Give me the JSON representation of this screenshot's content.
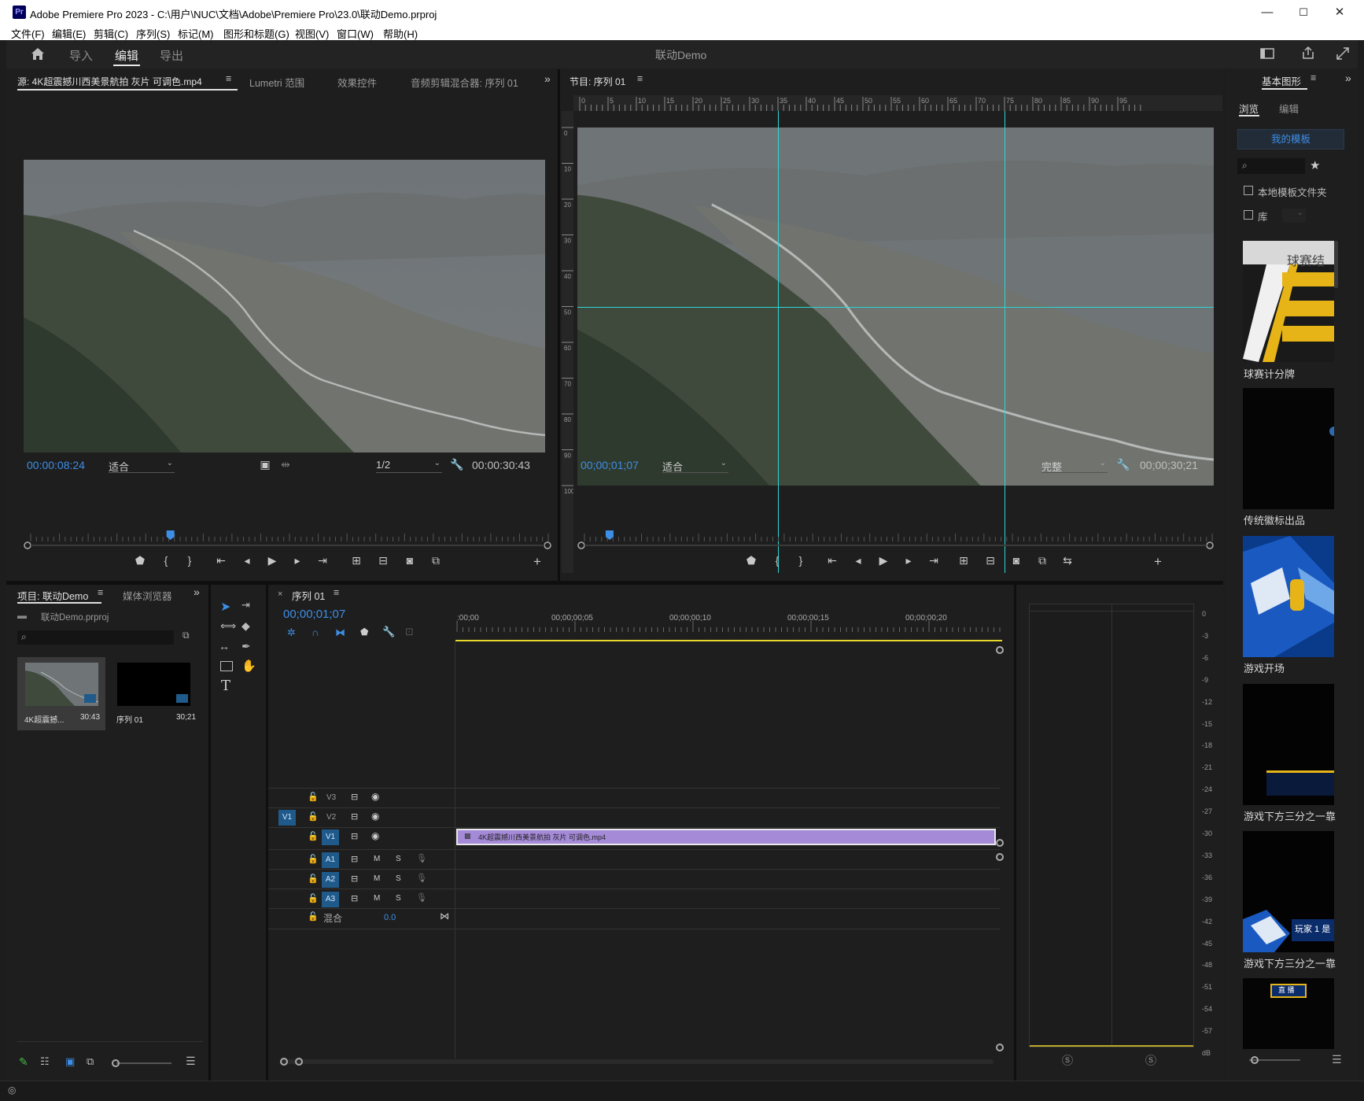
{
  "window": {
    "app_badge": "Pr",
    "title": "Adobe Premiere Pro 2023 - C:\\用户\\NUC\\文档\\Adobe\\Premiere Pro\\23.0\\联动Demo.prproj",
    "minimize": "—",
    "maximize": "☐",
    "close": "✕"
  },
  "menu": [
    "文件(F)",
    "编辑(E)",
    "剪辑(C)",
    "序列(S)",
    "标记(M)",
    "图形和标题(G)",
    "视图(V)",
    "窗口(W)",
    "帮助(H)"
  ],
  "workspace": {
    "tabs": [
      "导入",
      "编辑",
      "导出"
    ],
    "active": "编辑",
    "project_name": "联动Demo"
  },
  "source_panel": {
    "tabs": [
      "源: 4K超震撼川西美景航拍 灰片 可调色.mp4",
      "Lumetri 范围",
      "效果控件",
      "音频剪辑混合器: 序列 01"
    ],
    "current_time": "00:00:08:24",
    "fit": "适合",
    "resolution": "1/2",
    "duration": "00:00:30:43",
    "playhead_fraction": 0.27
  },
  "program_panel": {
    "tab": "节目: 序列 01",
    "ruler_ticks": [
      "0",
      "5",
      "10",
      "15",
      "20",
      "25",
      "30",
      "35",
      "40",
      "45",
      "50",
      "55",
      "60",
      "65",
      "70",
      "75",
      "80",
      "85",
      "90",
      "95"
    ],
    "v_ruler_ticks": [
      "0",
      "10",
      "20",
      "30",
      "40",
      "50",
      "60",
      "70",
      "80",
      "90",
      "100"
    ],
    "current_time": "00;00;01;07",
    "fit": "适合",
    "quality": "完整",
    "duration": "00;00;30;21",
    "playhead_fraction": 0.04
  },
  "project_panel": {
    "tabs": [
      "项目: 联动Demo",
      "媒体浏览器"
    ],
    "file": "联动Demo.prproj",
    "items": [
      {
        "name": "4K超震撼...",
        "duration": "30:43"
      },
      {
        "name": "序列 01",
        "duration": "30;21"
      }
    ]
  },
  "timeline": {
    "tab": "序列 01",
    "close": "×",
    "current_time": "00;00;01;07",
    "ruler_labels": [
      ":00;00",
      "00;00;00;05",
      "00;00;00;10",
      "00;00;00;15",
      "00;00;00;20"
    ],
    "video_tracks": [
      "V3",
      "V2",
      "V1"
    ],
    "source_patch": "V1",
    "audio_tracks": [
      "A1",
      "A2",
      "A3"
    ],
    "mix_label": "混合",
    "mix_value": "0.0",
    "clip_name": "4K超震撼川西美景航拍 灰片 可调色.mp4",
    "track_toggles": {
      "mute": "M",
      "solo": "S"
    }
  },
  "audio_meter": {
    "labels": [
      "0",
      "-3",
      "-6",
      "-9",
      "-12",
      "-15",
      "-18",
      "-21",
      "-24",
      "-27",
      "-30",
      "-33",
      "-36",
      "-39",
      "-42",
      "-45",
      "-48",
      "-51",
      "-54",
      "-57",
      "dB"
    ],
    "solo_left": "S",
    "solo_right": "S"
  },
  "essential_graphics": {
    "title": "基本图形",
    "tabs": [
      "浏览",
      "编辑"
    ],
    "my_templates": "我的模板",
    "local_folder": "本地模板文件夹",
    "library": "库",
    "templates": [
      {
        "name": "球赛计分牌",
        "overlay_text": "球赛结"
      },
      {
        "name": "传统徽标出品",
        "overlay_text": ""
      },
      {
        "name": "游戏开场",
        "overlay_text": ""
      },
      {
        "name": "游戏下方三分之一靠",
        "overlay_text": ""
      },
      {
        "name": "游戏下方三分之一靠",
        "overlay_text": "玩家 1 是"
      },
      {
        "name": "",
        "overlay_text": "直 播"
      }
    ]
  },
  "colors": {
    "accent_blue": "#3d8ee6",
    "guide": "#2dd6d6",
    "clip": "#a58ad8",
    "timeline_yellow": "#e8d82a"
  }
}
